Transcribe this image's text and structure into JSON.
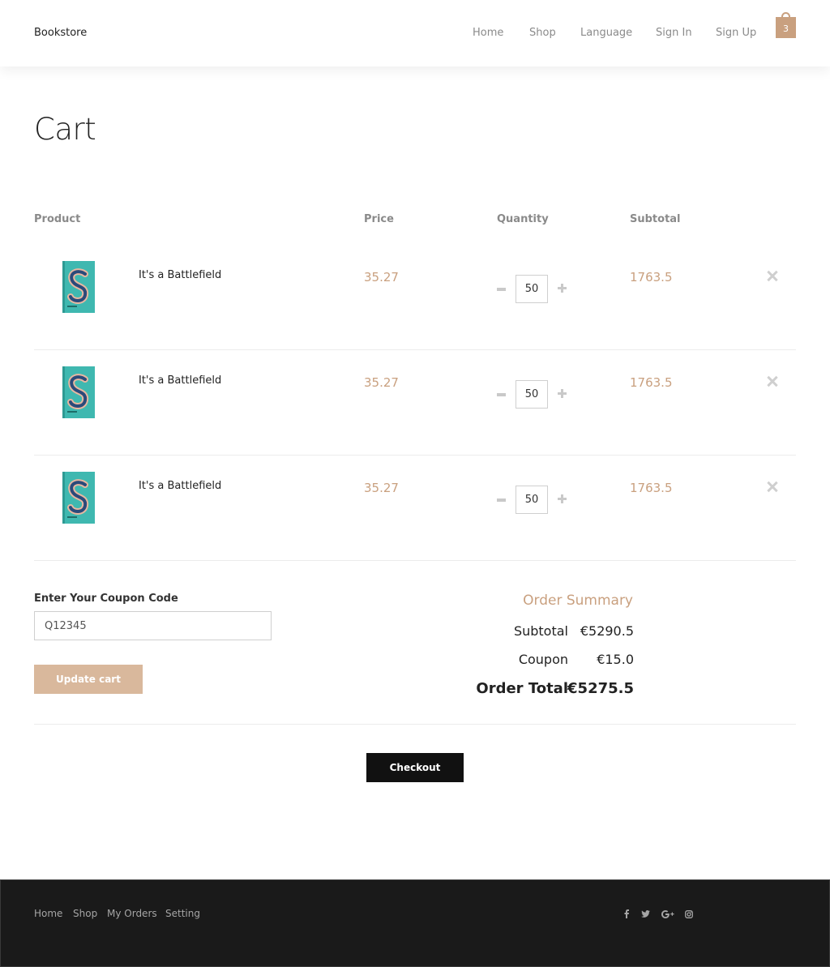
{
  "header": {
    "brand": "Bookstore",
    "nav": [
      "Home",
      "Shop",
      "Language",
      "Sign In",
      "Sign Up"
    ],
    "cart_count": "3"
  },
  "page_title": "Cart",
  "table": {
    "columns": [
      "Product",
      "Price",
      "Quantity",
      "Subtotal"
    ],
    "rows": [
      {
        "name": "It's a Battlefield",
        "price": "35.27",
        "quantity": "50",
        "subtotal": "1763.5"
      },
      {
        "name": "It's a Battlefield",
        "price": "35.27",
        "quantity": "50",
        "subtotal": "1763.5"
      },
      {
        "name": "It's a Battlefield",
        "price": "35.27",
        "quantity": "50",
        "subtotal": "1763.5"
      }
    ]
  },
  "coupon": {
    "label": "Enter Your Coupon Code",
    "value": "Q12345",
    "update_label": "Update cart"
  },
  "summary": {
    "title": "Order Summary",
    "subtotal_label": "Subtotal",
    "subtotal_value": "€5290.5",
    "coupon_label": "Coupon",
    "coupon_value": "€15.0",
    "total_label": "Order Total",
    "total_value": "€5275.5"
  },
  "checkout_label": "Checkout",
  "footer": {
    "links": [
      "Home",
      "Shop",
      "My Orders",
      "Setting"
    ],
    "social": [
      "f",
      "twitter",
      "G+",
      "instagram"
    ]
  },
  "colors": {
    "accent": "#c9a07f",
    "button_light": "#d9b89c",
    "footer_bg": "#1a1a1a"
  }
}
